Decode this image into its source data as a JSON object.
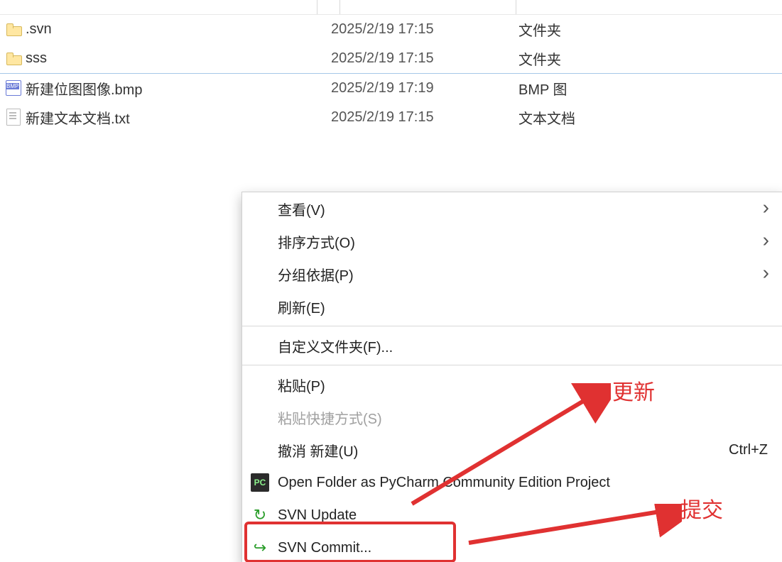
{
  "files": [
    {
      "name": ".svn",
      "date": "2025/2/19 17:15",
      "type": "文件夹",
      "icon": "folder"
    },
    {
      "name": "sss",
      "date": "2025/2/19 17:15",
      "type": "文件夹",
      "icon": "folder"
    },
    {
      "name": "新建位图图像.bmp",
      "date": "2025/2/19 17:19",
      "type": "BMP 图",
      "icon": "bmp"
    },
    {
      "name": "新建文本文档.txt",
      "date": "2025/2/19 17:15",
      "type": "文本文档",
      "icon": "txt"
    }
  ],
  "menu": {
    "view": "查看(V)",
    "sort": "排序方式(O)",
    "group": "分组依据(P)",
    "refresh": "刷新(E)",
    "customize": "自定义文件夹(F)...",
    "paste": "粘贴(P)",
    "paste_shortcut": "粘贴快捷方式(S)",
    "undo": "撤消 新建(U)",
    "undo_shortcut": "Ctrl+Z",
    "pycharm": "Open Folder as PyCharm Community Edition Project",
    "svn_update": "SVN Update",
    "svn_commit": "SVN Commit..."
  },
  "annotations": {
    "update_label": "更新",
    "commit_label": "提交"
  }
}
